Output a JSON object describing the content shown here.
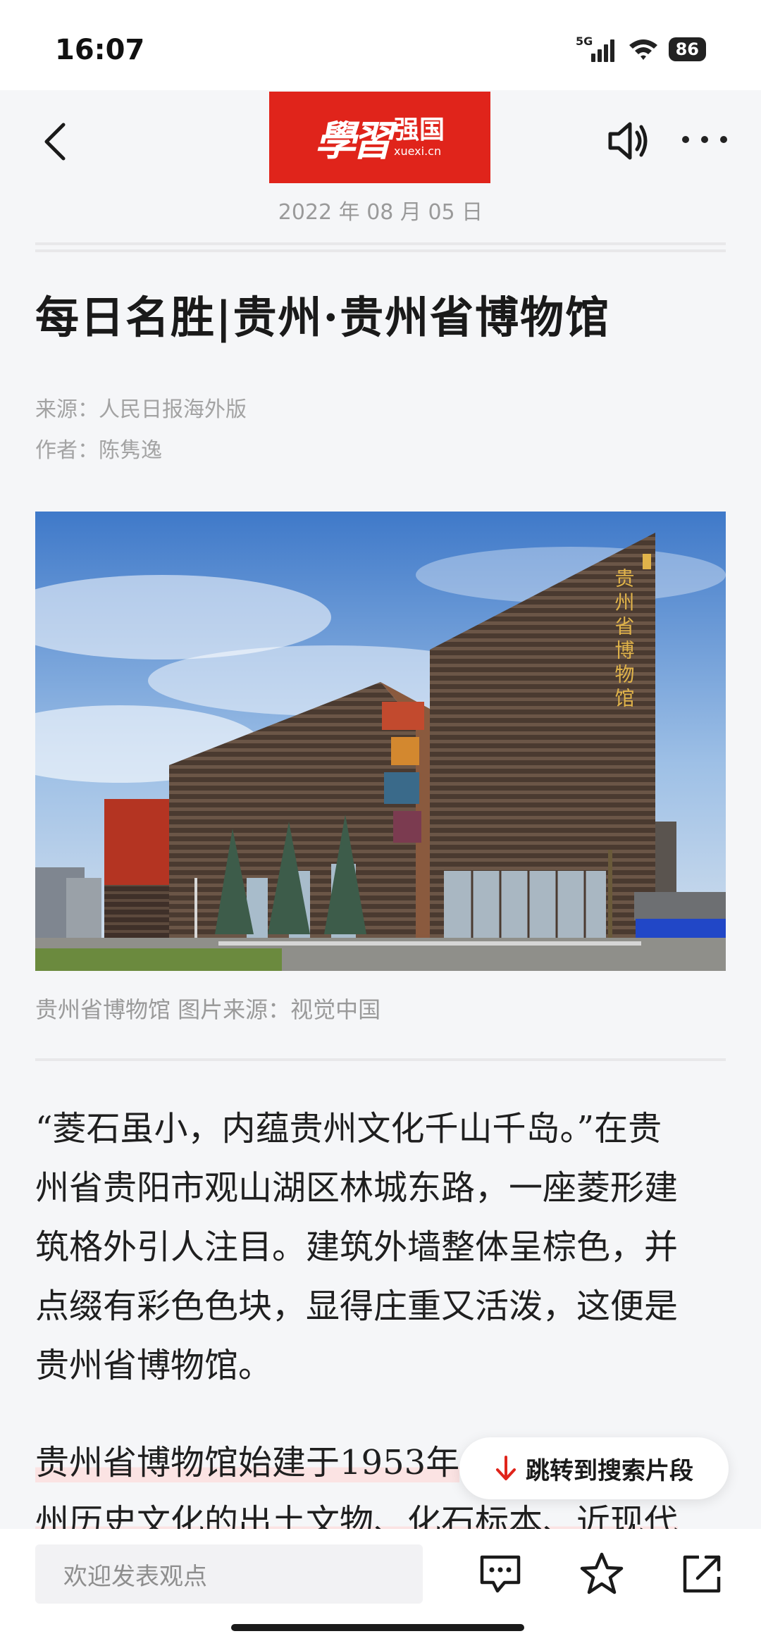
{
  "status_bar": {
    "time": "16:07",
    "network": "5G",
    "battery": "86"
  },
  "header": {
    "logo_calligraphy": "學習",
    "logo_name": "强国",
    "logo_domain": "xuexi.cn",
    "date": "2022 年 08 月 05 日"
  },
  "article": {
    "title": "每日名胜|贵州·贵州省博物馆",
    "source": "来源：人民日报海外版",
    "author": "作者：陈隽逸",
    "photo_text": "贵州省博物馆",
    "caption": "贵州省博物馆 图片来源：视觉中国",
    "para1_lines": [
      "“菱石虽小，内蕴贵州文化千山千岛。”在贵",
      "州省贵阳市观山湖区林城东路，一座菱形建",
      "筑格外引人注目。建筑外墙整体呈棕色，并",
      "点缀有彩色色块，显得庄重又活泼，这便是",
      "贵州省博物馆。"
    ],
    "para2_line1": "贵州省博物馆始建于1953年",
    "para2_line2": "州历史文化的出土文物、化石标本、近现代"
  },
  "jump_button": {
    "label": "跳转到搜索片段",
    "icon": "arrow-down-icon"
  },
  "bottom_bar": {
    "comment_placeholder": "欢迎发表观点",
    "icons": [
      "comment-icon",
      "star-icon",
      "share-icon"
    ]
  },
  "colors": {
    "brand_red": "#e0241b",
    "jump_arrow": "#e0241b",
    "highlight": "#fbe3e3"
  }
}
